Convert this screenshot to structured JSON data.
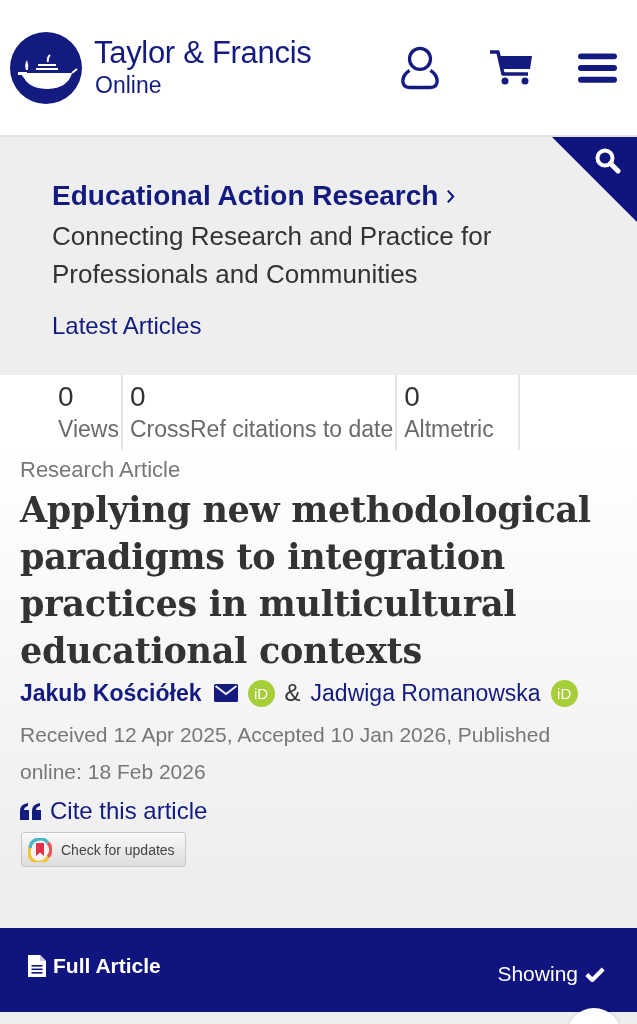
{
  "header": {
    "brand": "Taylor & Francis",
    "brand_sub": "Online"
  },
  "journal": {
    "title": "Educational Action Research",
    "subtitle": "Connecting Research and Practice for Professionals and Communities",
    "link": "Latest Articles"
  },
  "metrics": [
    {
      "value": "0",
      "label": "Views"
    },
    {
      "value": "0",
      "label": "CrossRef citations to date"
    },
    {
      "value": "0",
      "label": "Altmetric"
    }
  ],
  "article": {
    "type": "Research Article",
    "title": "Applying new methodological paradigms to integration practices in multicultural educational contexts",
    "authors": [
      {
        "name": "Jakub Kościółek",
        "corresponding": true,
        "orcid": "iD"
      },
      {
        "name": "Jadwiga Romanowska",
        "corresponding": false,
        "orcid": "iD"
      }
    ],
    "author_separator": "&",
    "dates": "Received 12 Apr 2025, Accepted 10 Jan 2026, Published online: 18 Feb 2026",
    "cite": "Cite this article",
    "check_updates": "Check for updates"
  },
  "full_article_bar": {
    "label": "Full Article",
    "status": "Showing"
  }
}
